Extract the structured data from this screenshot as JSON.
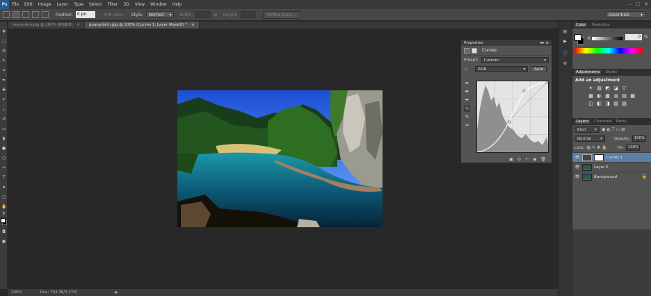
{
  "app": {
    "logo": "Ps"
  },
  "menu": [
    "File",
    "Edit",
    "Image",
    "Layer",
    "Type",
    "Select",
    "Filter",
    "3D",
    "View",
    "Window",
    "Help"
  ],
  "window_controls": [
    "–",
    "□",
    "✕"
  ],
  "options_bar": {
    "feather_label": "Feather:",
    "feather_value": "0 px",
    "anti_alias_label": "Anti-alias",
    "style_label": "Style:",
    "style_value": "Normal",
    "width_label": "Width:",
    "height_label": "Height:",
    "refine_edge": "Refine Edge...",
    "workspace": "Essentials"
  },
  "tabs": [
    {
      "label": "mang-den.jpg @ 100% (RGB/8)",
      "close": "×"
    },
    {
      "label": "quang-binh.jpg @ 100% (Curves 1, Layer Mask/8) *",
      "close": "×"
    }
  ],
  "status": {
    "zoom": "100%",
    "doc": "Doc: 793.3K/3.37M",
    "arrow": "▶"
  },
  "properties": {
    "header": "Properties",
    "header_icons": "▸▸ ≡",
    "title": "Curves",
    "preset_label": "Preset:",
    "preset_value": "Custom",
    "channel_value": "RGB",
    "auto_label": "Auto",
    "footer_icons": [
      "▣",
      "◎",
      "↶",
      "◉",
      "🗑"
    ]
  },
  "color_panel": {
    "tabs": [
      "Color",
      "Swatches"
    ],
    "k_label": "K",
    "k_value": "0",
    "pct": "%"
  },
  "adjustments_panel": {
    "tabs": [
      "Adjustments",
      "Styles"
    ],
    "title": "Add an adjustment",
    "icons": [
      "☀",
      "▥",
      "◩",
      "◪",
      "▽",
      "",
      "▦",
      "◐",
      "▩",
      "◍",
      "▤",
      "▦",
      "◫",
      "◧",
      "◨",
      "▧",
      "▨",
      ""
    ]
  },
  "layers_panel": {
    "tabs": [
      "Layers",
      "Channels",
      "Paths"
    ],
    "kind_value": "Kind",
    "blend_value": "Normal",
    "opacity_label": "Opacity:",
    "opacity_value": "100%",
    "lock_label": "Lock:",
    "fill_label": "Fill:",
    "fill_value": "100%",
    "layers": [
      {
        "name": "Curves 1",
        "selected": true
      },
      {
        "name": "Layer 0",
        "selected": false
      },
      {
        "name": "Background",
        "selected": false,
        "locked": true
      }
    ]
  },
  "colors": {
    "ui_dark": "#282828",
    "panel": "#535353",
    "selection": "#5b7ea6",
    "logo": "#2b5a8a"
  }
}
